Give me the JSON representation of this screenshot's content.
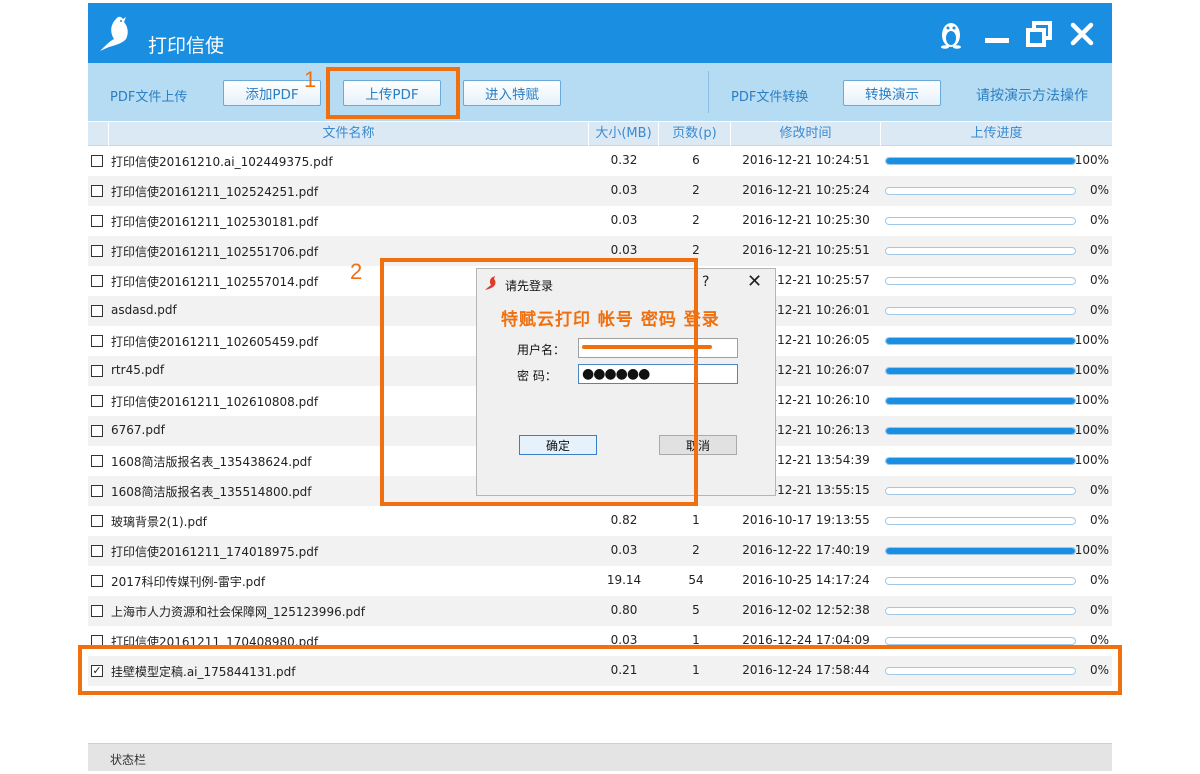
{
  "app": {
    "title": "打印信使",
    "colors": {
      "titlebar": "#1a8ee0",
      "toolbar": "#b6dcf4",
      "highlight": "#f07010",
      "progress": "#1a8ee0"
    },
    "icons": {
      "logo": "pigeon-icon",
      "user": "penguin-icon",
      "minimize": "minimize-icon",
      "restore": "restore-icon",
      "close": "close-icon"
    }
  },
  "toolbar": {
    "upload_label": "PDF文件上传",
    "add_pdf": "添加PDF",
    "upload_pdf": "上传PDF",
    "enter_tefu": "进入特赋",
    "convert_label": "PDF文件转换",
    "convert_demo": "转换演示",
    "hint": "请按演示方法操作"
  },
  "annotations": {
    "one": "1",
    "two": "2"
  },
  "table": {
    "headers": [
      "文件名称",
      "大小(MB)",
      "页数(p)",
      "修改时间",
      "上传进度"
    ],
    "rows": [
      {
        "name": "打印信使20161210.ai_102449375.pdf",
        "size": "0.32",
        "pages": "6",
        "time": "2016-12-21 10:24:51",
        "progress": 100,
        "pct": "100%",
        "checked": false
      },
      {
        "name": "打印信使20161211_102524251.pdf",
        "size": "0.03",
        "pages": "2",
        "time": "2016-12-21 10:25:24",
        "progress": 0,
        "pct": "0%",
        "checked": false
      },
      {
        "name": "打印信使20161211_102530181.pdf",
        "size": "0.03",
        "pages": "2",
        "time": "2016-12-21 10:25:30",
        "progress": 0,
        "pct": "0%",
        "checked": false
      },
      {
        "name": "打印信使20161211_102551706.pdf",
        "size": "0.03",
        "pages": "2",
        "time": "2016-12-21 10:25:51",
        "progress": 0,
        "pct": "0%",
        "checked": false
      },
      {
        "name": "打印信使20161211_102557014.pdf",
        "size": "",
        "pages": "",
        "time": "2016-12-21 10:25:57",
        "progress": 0,
        "pct": "0%",
        "checked": false
      },
      {
        "name": "asdasd.pdf",
        "size": "",
        "pages": "",
        "time": "2016-12-21 10:26:01",
        "progress": 0,
        "pct": "0%",
        "checked": false
      },
      {
        "name": "打印信使20161211_102605459.pdf",
        "size": "",
        "pages": "",
        "time": "2016-12-21 10:26:05",
        "progress": 100,
        "pct": "100%",
        "checked": false
      },
      {
        "name": "rtr45.pdf",
        "size": "",
        "pages": "",
        "time": "2016-12-21 10:26:07",
        "progress": 100,
        "pct": "100%",
        "checked": false
      },
      {
        "name": "打印信使20161211_102610808.pdf",
        "size": "",
        "pages": "",
        "time": "2016-12-21 10:26:10",
        "progress": 100,
        "pct": "100%",
        "checked": false
      },
      {
        "name": "6767.pdf",
        "size": "",
        "pages": "",
        "time": "2016-12-21 10:26:13",
        "progress": 100,
        "pct": "100%",
        "checked": false
      },
      {
        "name": "1608简洁版报名表_135438624.pdf",
        "size": "",
        "pages": "",
        "time": "2016-12-21 13:54:39",
        "progress": 100,
        "pct": "100%",
        "checked": false
      },
      {
        "name": "1608简洁版报名表_135514800.pdf",
        "size": "",
        "pages": "",
        "time": "2016-12-21 13:55:15",
        "progress": 0,
        "pct": "0%",
        "checked": false
      },
      {
        "name": "玻璃背景2(1).pdf",
        "size": "0.82",
        "pages": "1",
        "time": "2016-10-17 19:13:55",
        "progress": 0,
        "pct": "0%",
        "checked": false
      },
      {
        "name": "打印信使20161211_174018975.pdf",
        "size": "0.03",
        "pages": "2",
        "time": "2016-12-22 17:40:19",
        "progress": 100,
        "pct": "100%",
        "checked": false
      },
      {
        "name": "2017科印传媒刊例-雷宇.pdf",
        "size": "19.14",
        "pages": "54",
        "time": "2016-10-25 14:17:24",
        "progress": 0,
        "pct": "0%",
        "checked": false
      },
      {
        "name": "上海市人力资源和社会保障网_125123996.pdf",
        "size": "0.80",
        "pages": "5",
        "time": "2016-12-02 12:52:38",
        "progress": 0,
        "pct": "0%",
        "checked": false
      },
      {
        "name": "打印信使20161211_170408980.pdf",
        "size": "0.03",
        "pages": "1",
        "time": "2016-12-24 17:04:09",
        "progress": 0,
        "pct": "0%",
        "checked": false
      },
      {
        "name": "挂壁模型定稿.ai_175844131.pdf",
        "size": "0.21",
        "pages": "1",
        "time": "2016-12-24 17:58:44",
        "progress": 0,
        "pct": "0%",
        "checked": true
      }
    ]
  },
  "status": {
    "text": "状态栏"
  },
  "dialog": {
    "title": "请先登录",
    "help": "?",
    "close": "✕",
    "heading": "特赋云打印  帐号  密码  登录",
    "username_label": "用户名：",
    "password_label": "密    码：",
    "password_value": "●●●●●●",
    "ok": "确定",
    "cancel": "取消"
  }
}
